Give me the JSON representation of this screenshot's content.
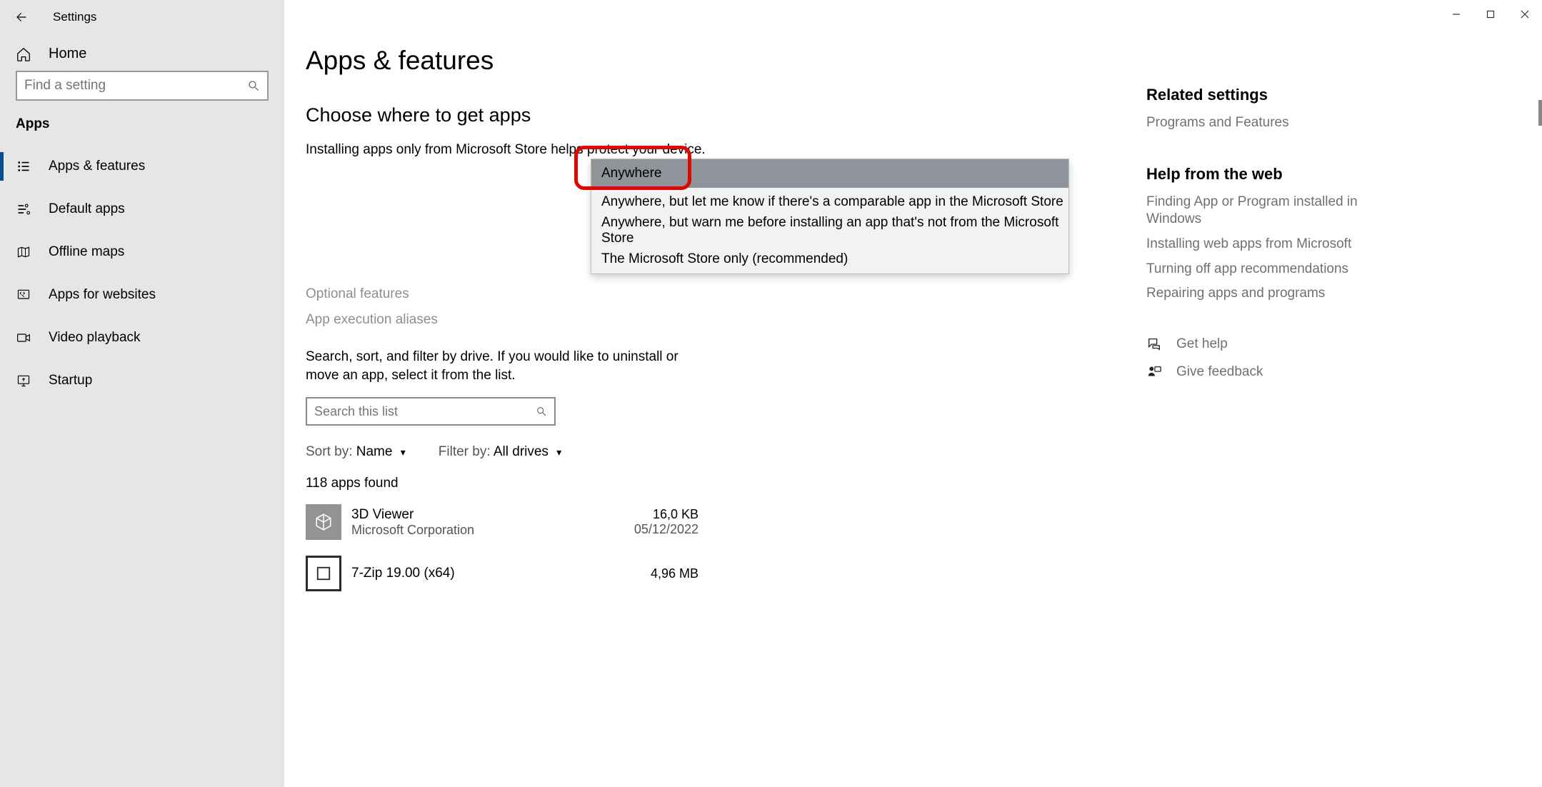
{
  "title": "Settings",
  "home_label": "Home",
  "search_placeholder": "Find a setting",
  "category": "Apps",
  "nav": [
    {
      "label": "Apps & features",
      "icon": "apps-features-icon",
      "active": true
    },
    {
      "label": "Default apps",
      "icon": "default-apps-icon",
      "active": false
    },
    {
      "label": "Offline maps",
      "icon": "offline-maps-icon",
      "active": false
    },
    {
      "label": "Apps for websites",
      "icon": "apps-websites-icon",
      "active": false
    },
    {
      "label": "Video playback",
      "icon": "video-playback-icon",
      "active": false
    },
    {
      "label": "Startup",
      "icon": "startup-icon",
      "active": false
    }
  ],
  "main": {
    "page_title": "Apps & features",
    "section_title": "Choose where to get apps",
    "section_desc": "Installing apps only from Microsoft Store helps protect your device.",
    "dropdown_options": [
      "Anywhere",
      "Anywhere, but let me know if there's a comparable app in the Microsoft Store",
      "Anywhere, but warn me before installing an app that's not from the Microsoft Store",
      "The Microsoft Store only (recommended)"
    ],
    "dropdown_selected_index": 0,
    "link_optional": "Optional features",
    "link_aliases": "App execution aliases",
    "list_desc": "Search, sort, and filter by drive. If you would like to uninstall or move an app, select it from the list.",
    "list_search_placeholder": "Search this list",
    "sort_label": "Sort by:",
    "sort_value": "Name",
    "filter_label": "Filter by:",
    "filter_value": "All drives",
    "count_text": "118 apps found",
    "apps": [
      {
        "name": "3D Viewer",
        "publisher": "Microsoft Corporation",
        "size": "16,0 KB",
        "date": "05/12/2022"
      },
      {
        "name": "7-Zip 19.00 (x64)",
        "publisher": "",
        "size": "4,96 MB",
        "date": ""
      }
    ]
  },
  "rail": {
    "related_heading": "Related settings",
    "related_links": [
      "Programs and Features"
    ],
    "help_heading": "Help from the web",
    "help_links": [
      "Finding App or Program installed in Windows",
      "Installing web apps from Microsoft",
      "Turning off app recommendations",
      "Repairing apps and programs"
    ],
    "get_help": "Get help",
    "give_feedback": "Give feedback"
  }
}
